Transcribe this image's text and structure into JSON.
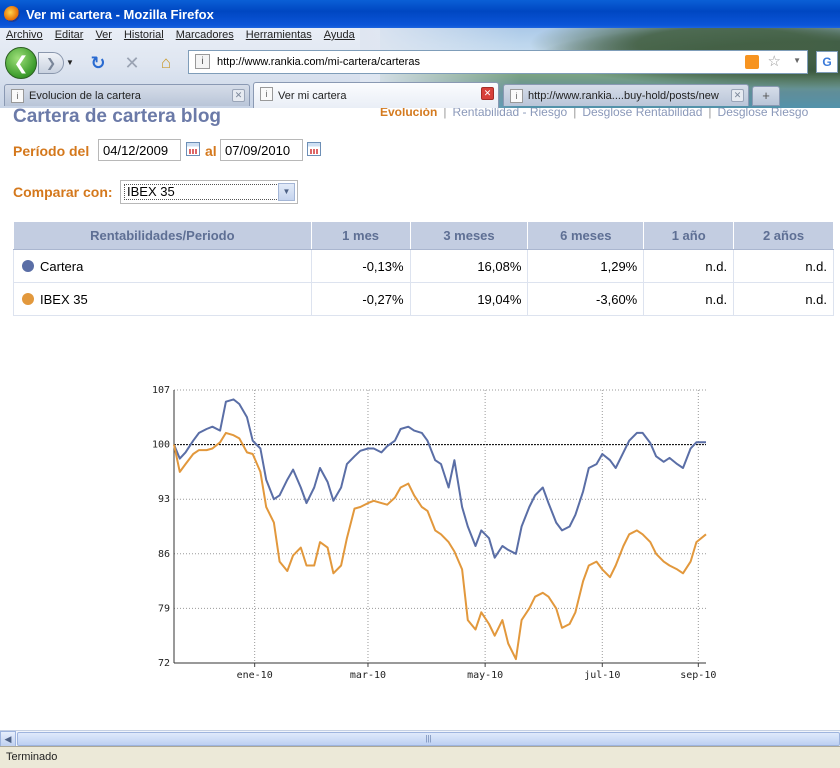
{
  "window": {
    "title": "Ver mi cartera - Mozilla Firefox"
  },
  "menu": [
    "Archivo",
    "Editar",
    "Ver",
    "Historial",
    "Marcadores",
    "Herramientas",
    "Ayuda"
  ],
  "navbar": {
    "url": "http://www.rankia.com/mi-cartera/carteras"
  },
  "tabs": [
    {
      "label": "Evolucion de la cartera"
    },
    {
      "label": "Ver mi cartera"
    },
    {
      "label": "http://www.rankia....buy-hold/posts/new"
    }
  ],
  "page": {
    "title": "Cartera de cartera blog",
    "subnav": [
      "Evolución",
      "Rentabilidad - Riesgo",
      "Desglose Rentabilidad",
      "Desglose Riesgo"
    ],
    "period_label": "Período del",
    "date_from": "04/12/2009",
    "al_label": "al",
    "date_to": "07/09/2010",
    "compare_label": "Comparar con:",
    "compare_value": "IBEX 35"
  },
  "table": {
    "headers": [
      "Rentabilidades/Periodo",
      "1 mes",
      "3 meses",
      "6 meses",
      "1 año",
      "2 años"
    ],
    "rows": [
      {
        "name": "Cartera",
        "color": "#5a6ea6",
        "values": [
          "-0,13%",
          "16,08%",
          "1,29%",
          "n.d.",
          "n.d."
        ]
      },
      {
        "name": "IBEX 35",
        "color": "#e2983c",
        "values": [
          "-0,27%",
          "19,04%",
          "-3,60%",
          "n.d.",
          "n.d."
        ]
      }
    ]
  },
  "chart_data": {
    "type": "line",
    "y_ticks": [
      "107",
      "100",
      "93",
      "86",
      "79",
      "72"
    ],
    "x_ticks": [
      "ene-10",
      "mar-10",
      "may-10",
      "jul-10",
      "sep-10"
    ],
    "ylim": [
      72,
      107
    ],
    "reference_line": 100,
    "x_dates": [
      "2009-12-04",
      "2009-12-07",
      "2009-12-10",
      "2009-12-14",
      "2009-12-17",
      "2009-12-21",
      "2009-12-24",
      "2009-12-28",
      "2009-12-31",
      "2010-01-04",
      "2010-01-07",
      "2010-01-11",
      "2010-01-14",
      "2010-01-18",
      "2010-01-21",
      "2010-01-25",
      "2010-01-28",
      "2010-02-01",
      "2010-02-04",
      "2010-02-08",
      "2010-02-11",
      "2010-02-15",
      "2010-02-18",
      "2010-02-22",
      "2010-02-25",
      "2010-03-01",
      "2010-03-04",
      "2010-03-08",
      "2010-03-11",
      "2010-03-15",
      "2010-03-18",
      "2010-03-22",
      "2010-03-25",
      "2010-03-29",
      "2010-04-01",
      "2010-04-05",
      "2010-04-08",
      "2010-04-12",
      "2010-04-15",
      "2010-04-19",
      "2010-04-22",
      "2010-04-26",
      "2010-04-29",
      "2010-05-03",
      "2010-05-06",
      "2010-05-10",
      "2010-05-13",
      "2010-05-17",
      "2010-05-20",
      "2010-05-24",
      "2010-05-27",
      "2010-05-31",
      "2010-06-03",
      "2010-06-07",
      "2010-06-10",
      "2010-06-14",
      "2010-06-17",
      "2010-06-21",
      "2010-06-24",
      "2010-06-28",
      "2010-07-01",
      "2010-07-05",
      "2010-07-08",
      "2010-07-12",
      "2010-07-15",
      "2010-07-19",
      "2010-07-22",
      "2010-07-26",
      "2010-07-29",
      "2010-08-02",
      "2010-08-05",
      "2010-08-09",
      "2010-08-12",
      "2010-08-16",
      "2010-08-19",
      "2010-08-23",
      "2010-08-26",
      "2010-08-30",
      "2010-09-02",
      "2010-09-07"
    ],
    "series": [
      {
        "name": "Cartera",
        "color": "#5a6ea6",
        "values": [
          100,
          98.2,
          99.0,
          100.5,
          101.5,
          102.0,
          102.3,
          101.8,
          105.5,
          105.8,
          105.2,
          103.5,
          100.5,
          99.5,
          95.5,
          93.0,
          93.5,
          95.5,
          96.8,
          94.5,
          92.5,
          94.5,
          97.0,
          95.2,
          92.8,
          94.5,
          97.5,
          98.5,
          99.2,
          99.5,
          99.5,
          99.0,
          99.8,
          100.5,
          102.0,
          102.3,
          101.8,
          101.5,
          100.5,
          98.0,
          97.5,
          94.5,
          98.0,
          92.0,
          89.5,
          87.0,
          89.0,
          88.0,
          85.5,
          87.0,
          86.5,
          86.0,
          89.5,
          92.0,
          93.5,
          94.5,
          92.5,
          90.0,
          89.0,
          89.5,
          91.0,
          94.0,
          97.0,
          97.5,
          98.8,
          98.0,
          97.0,
          99.0,
          100.5,
          101.5,
          101.5,
          100.2,
          98.5,
          97.8,
          98.3,
          97.5,
          97.0,
          99.5,
          100.3,
          100.3
        ]
      },
      {
        "name": "IBEX 35",
        "color": "#e2983c",
        "values": [
          100,
          96.5,
          97.5,
          98.8,
          99.3,
          99.3,
          99.5,
          100.3,
          101.5,
          101.2,
          100.8,
          99.0,
          98.8,
          96.5,
          92.0,
          90.0,
          85.0,
          83.8,
          85.8,
          86.8,
          84.5,
          84.5,
          87.5,
          86.8,
          83.5,
          84.5,
          88.0,
          91.8,
          92.0,
          92.5,
          92.8,
          92.5,
          92.3,
          93.2,
          94.5,
          95.0,
          93.5,
          92.0,
          91.5,
          89.0,
          88.5,
          87.5,
          86.3,
          84.0,
          77.5,
          76.3,
          78.5,
          77.0,
          75.5,
          77.5,
          74.5,
          72.5,
          77.5,
          79.0,
          80.5,
          81.0,
          80.5,
          79.0,
          76.5,
          77.0,
          78.5,
          82.5,
          84.5,
          85.0,
          84.0,
          83.0,
          84.5,
          87.0,
          88.5,
          89.0,
          88.5,
          87.5,
          86.0,
          85.0,
          84.5,
          84.0,
          83.5,
          85.0,
          87.5,
          88.5
        ]
      }
    ]
  },
  "scrollbar": {
    "grip": "|||"
  },
  "statusbar": {
    "text": "Terminado"
  }
}
